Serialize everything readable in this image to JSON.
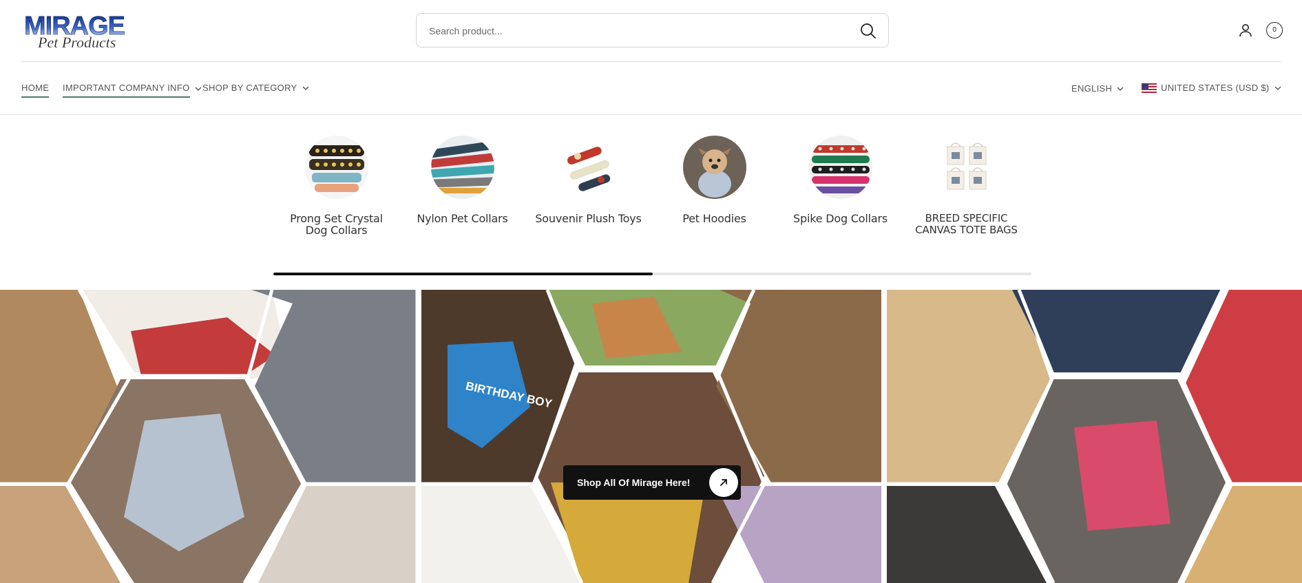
{
  "brand": {
    "logo_top": "MIRAGE",
    "logo_bottom": "Pet Products"
  },
  "search": {
    "placeholder": "Search product..."
  },
  "header": {
    "cart_count": "0"
  },
  "nav": {
    "items": [
      {
        "label": "HOME",
        "has_dropdown": false
      },
      {
        "label": "IMPORTANT COMPANY INFO",
        "has_dropdown": true
      },
      {
        "label": "SHOP BY CATEGORY",
        "has_dropdown": true
      }
    ],
    "language": "ENGLISH",
    "currency": "UNITED STATES (USD $)"
  },
  "categories": [
    {
      "name": "Prong Set Crystal Dog Collars",
      "icon": "crystal-collar"
    },
    {
      "name": "Nylon Pet Collars",
      "icon": "nylon-collars"
    },
    {
      "name": "Souvenir Plush Toys",
      "icon": "plush-bone-toys"
    },
    {
      "name": "Pet Hoodies",
      "icon": "dog-in-hoodie"
    },
    {
      "name": "Spike Dog Collars",
      "icon": "spike-collars"
    },
    {
      "name": "BREED SPECIFIC CANVAS TOTE BAGS",
      "icon": "tote-bags"
    }
  ],
  "carousel": {
    "progress": 0.5
  },
  "hero": {
    "cta_label": "Shop All Of Mirage Here!",
    "bandana_text": "BIRTHDAY BOY",
    "colors": {
      "accent": "#111111",
      "link_underline": "#4d7a6d"
    }
  }
}
